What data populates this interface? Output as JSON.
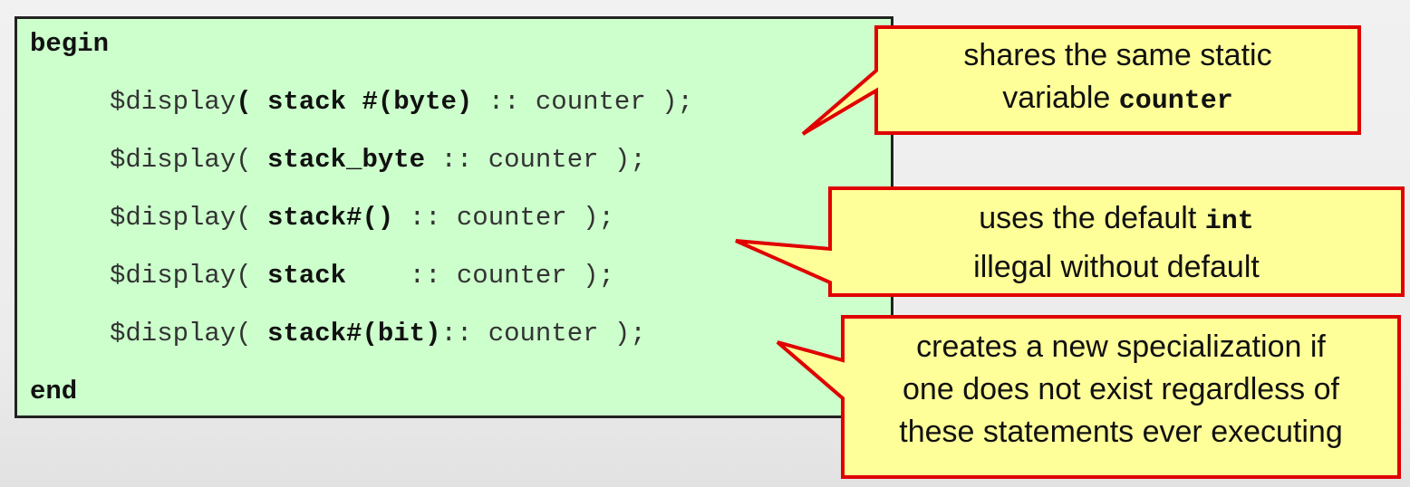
{
  "code": {
    "begin": "begin",
    "end": "end",
    "lines": [
      {
        "fn": "$display",
        "open": "( ",
        "type": "stack #(byte)",
        "rest": " :: counter );"
      },
      {
        "fn": "$display",
        "open": "( ",
        "type": "stack_byte",
        "rest": " :: counter );"
      },
      {
        "fn": "$display",
        "open": "( ",
        "type": "stack#()",
        "rest": " :: counter );"
      },
      {
        "fn": "$display",
        "open": "( ",
        "type": "stack   ",
        "rest": " :: counter );"
      },
      {
        "fn": "$display",
        "open": "( ",
        "type": "stack#(bit)",
        "rest": ":: counter );"
      }
    ]
  },
  "callouts": [
    {
      "line1": "shares the same static",
      "line2_text": "variable ",
      "line2_code": "counter"
    },
    {
      "line1_text": "uses the default ",
      "line1_code": "int",
      "line2": "illegal without default"
    },
    {
      "line1": "creates a new specialization if",
      "line2": "one does not exist regardless of",
      "line3": "these statements ever executing"
    }
  ],
  "colors": {
    "code_background": "#ccffcc",
    "callout_fill": "#ffff99",
    "callout_border": "#e00000"
  }
}
